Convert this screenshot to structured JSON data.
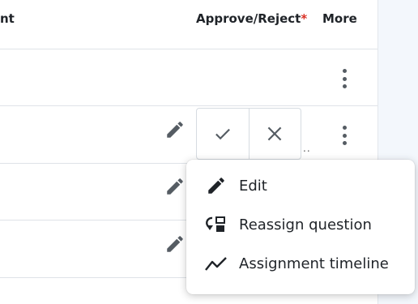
{
  "table": {
    "columns": {
      "comment_partial": "nt",
      "approve_reject": "Approve/Reject",
      "required_mark": "*",
      "more": "More"
    },
    "truncation_mark": ".."
  },
  "context_menu": {
    "items": [
      {
        "label": "Edit",
        "icon": "pencil-icon"
      },
      {
        "label": "Reassign question",
        "icon": "reassign-icon"
      },
      {
        "label": "Assignment timeline",
        "icon": "timeline-icon"
      }
    ]
  },
  "colors": {
    "icon_gray": "#555c63",
    "required_red": "#d93025",
    "right_pane_bg": "#f3f7fc"
  }
}
